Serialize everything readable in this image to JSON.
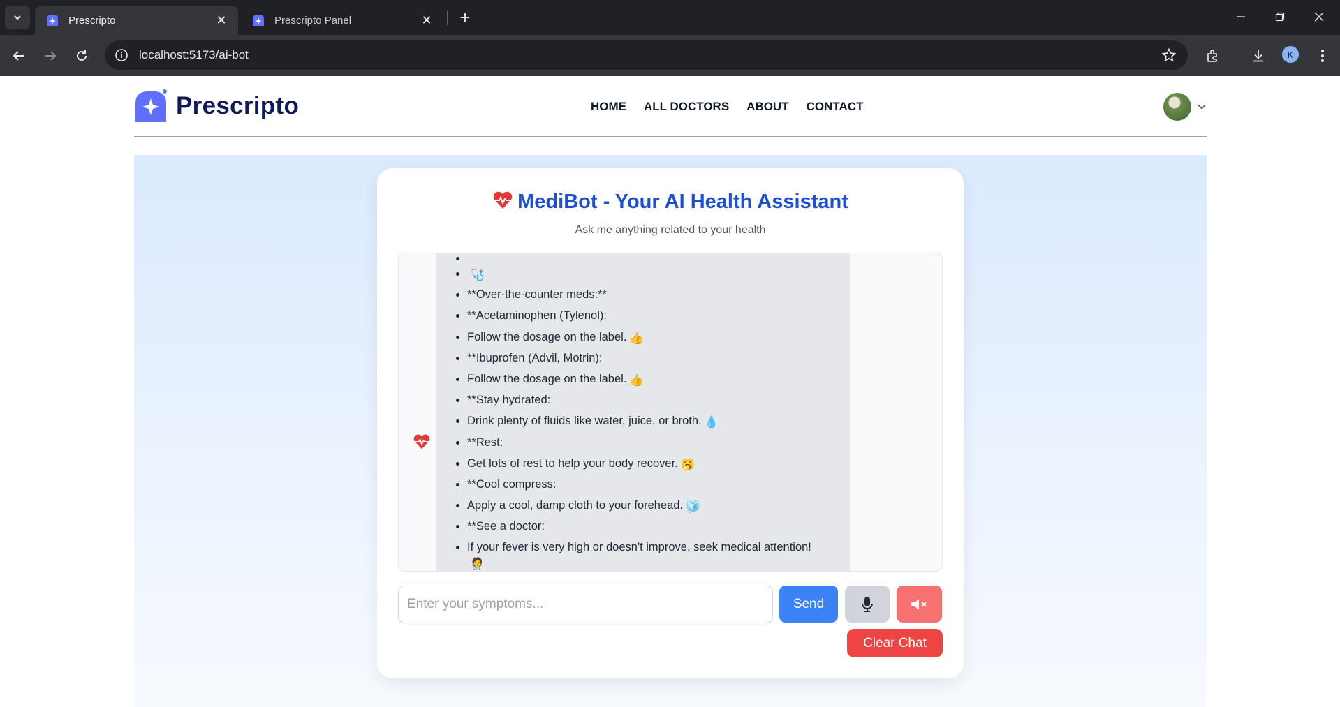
{
  "browser": {
    "tabs": [
      {
        "title": "Prescripto",
        "active": true
      },
      {
        "title": "Prescripto Panel",
        "active": false
      }
    ],
    "url": "localhost:5173/ai-bot",
    "profile_initial": "K",
    "icons": [
      "tab-search-icon",
      "back-icon",
      "forward-icon",
      "reload-icon",
      "site-info-icon",
      "bookmark-star-icon",
      "extensions-icon",
      "download-icon",
      "menu-dots-icon",
      "minimize-icon",
      "restore-icon",
      "close-icon"
    ]
  },
  "site": {
    "brand": "Prescripto",
    "menu": [
      "HOME",
      "ALL DOCTORS",
      "ABOUT",
      "CONTACT"
    ],
    "accent": "#1d4ed8"
  },
  "chat": {
    "title": "MediBot - Your AI Health Assistant",
    "subtitle": "Ask me anything related to your health",
    "bot_icon": "heart-pulse-icon",
    "messages": [
      {
        "text": "",
        "emoji": "🩺"
      },
      {
        "text": "**Over-the-counter meds:**",
        "emoji": ""
      },
      {
        "text": "**Acetaminophen (Tylenol):",
        "emoji": ""
      },
      {
        "text": "Follow the dosage on the label.",
        "emoji": "👍"
      },
      {
        "text": "**Ibuprofen (Advil, Motrin):",
        "emoji": ""
      },
      {
        "text": "Follow the dosage on the label.",
        "emoji": "👍"
      },
      {
        "text": "**Stay hydrated:",
        "emoji": ""
      },
      {
        "text": "Drink plenty of fluids like water, juice, or broth.",
        "emoji": "💧"
      },
      {
        "text": "**Rest:",
        "emoji": ""
      },
      {
        "text": "Get lots of rest to help your body recover.",
        "emoji": "🥱"
      },
      {
        "text": "**Cool compress:",
        "emoji": ""
      },
      {
        "text": "Apply a cool, damp cloth to your forehead.",
        "emoji": "🧊"
      },
      {
        "text": "**See a doctor:",
        "emoji": ""
      },
      {
        "text": "If your fever is very high or doesn't improve, seek medical attention!",
        "emoji": "🧑‍⚕️"
      }
    ],
    "input_placeholder": "Enter your symptoms...",
    "send_label": "Send",
    "clear_label": "Clear Chat",
    "mic_icon": "microphone-icon",
    "mute_icon": "speaker-muted-icon"
  }
}
